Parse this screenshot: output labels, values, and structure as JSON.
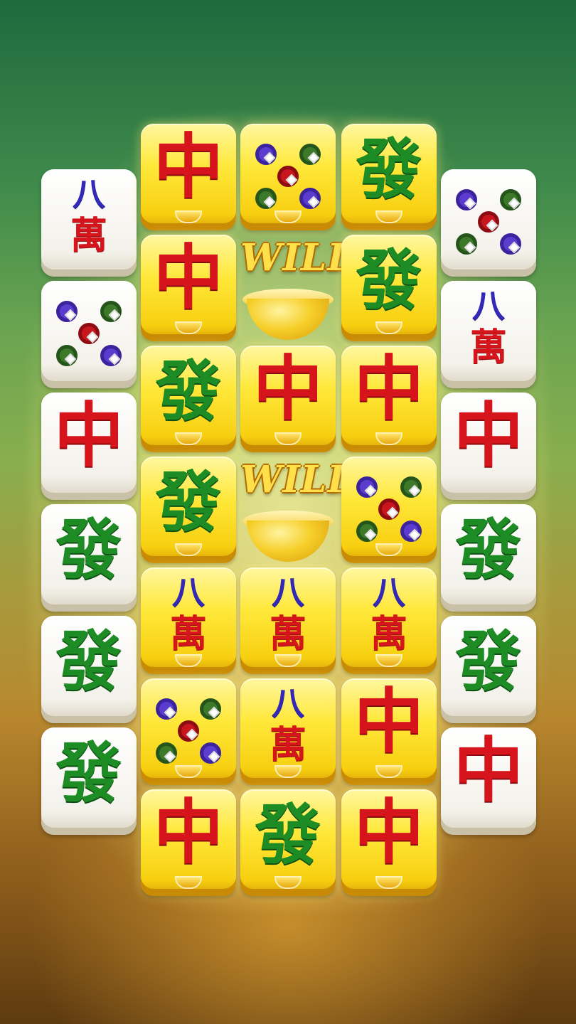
{
  "game": {
    "reels": [
      [
        "ba_wan",
        "circles",
        "zhong",
        "fa",
        "fa",
        "fa"
      ],
      [
        "zhong",
        "zhong",
        "fa",
        "fa",
        "ba_wan",
        "circles",
        "zhong"
      ],
      [
        "circles",
        "wild",
        "zhong",
        "wild",
        "ba_wan",
        "ba_wan",
        "fa"
      ],
      [
        "fa",
        "fa",
        "zhong",
        "circles",
        "ba_wan",
        "zhong",
        "zhong"
      ],
      [
        "circles",
        "ba_wan",
        "zhong",
        "fa",
        "fa",
        "zhong"
      ]
    ],
    "gold_reels": [
      1,
      2,
      3
    ],
    "glyphs": {
      "zhong": "中",
      "fa": "發",
      "ba": "八",
      "wan": "萬"
    },
    "wild_label": "WILD"
  },
  "colors": {
    "zhong": "#d6141b",
    "fa": "#1e8c24",
    "ba": "#3329b8",
    "gold_tile": "#ffe83a",
    "white_tile": "#f3f1ea"
  }
}
